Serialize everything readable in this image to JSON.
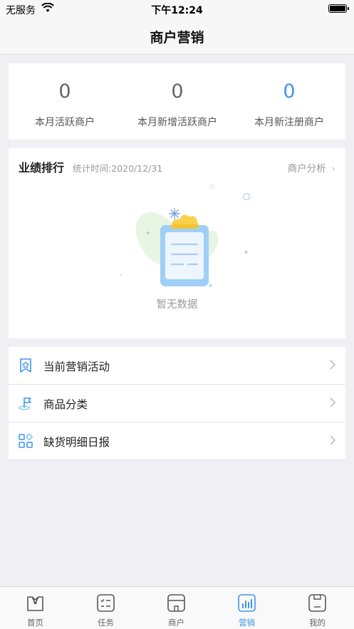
{
  "status_bar": {
    "carrier": "无服务",
    "time": "下午12:24"
  },
  "nav": {
    "title": "商户营销"
  },
  "stats": [
    {
      "value": "0",
      "label": "本月活跃商户"
    },
    {
      "value": "0",
      "label": "本月新增活跃商户"
    },
    {
      "value": "0",
      "label": "本月新注册商户"
    }
  ],
  "performance": {
    "title": "业绩排行",
    "subtitle": "统计时间:2020/12/31",
    "link": "商户分析",
    "empty_text": "暂无数据"
  },
  "menu": [
    {
      "label": "当前营销活动",
      "icon": "bookmark-star-icon"
    },
    {
      "label": "商品分类",
      "icon": "flag-icon"
    },
    {
      "label": "缺货明细日报",
      "icon": "grid-icon"
    }
  ],
  "tabs": [
    {
      "label": "首页",
      "icon": "home-shirt-icon",
      "active": false
    },
    {
      "label": "任务",
      "icon": "task-list-icon",
      "active": false
    },
    {
      "label": "商户",
      "icon": "store-icon",
      "active": false
    },
    {
      "label": "营销",
      "icon": "bar-chart-icon",
      "active": true
    },
    {
      "label": "我的",
      "icon": "profile-icon",
      "active": false
    }
  ],
  "colors": {
    "accent": "#3f94f0",
    "background": "#efeff4",
    "highlight_stat": "#3f94f0"
  }
}
